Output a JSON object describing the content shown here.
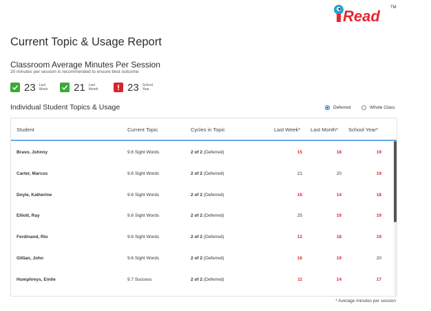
{
  "logo": {
    "text": "iRead",
    "tm": "TM"
  },
  "title": "Current Topic & Usage Report",
  "classroom": {
    "title": "Classroom Average Minutes Per Session",
    "subtitle": "20 minutes per session is recommended to ensure best outcome",
    "stats": [
      {
        "value": "23",
        "label1": "Last",
        "label2": "Week",
        "status": "green",
        "icon": "check-icon"
      },
      {
        "value": "21",
        "label1": "Last",
        "label2": "Month",
        "status": "green",
        "icon": "check-icon"
      },
      {
        "value": "23",
        "label1": "School",
        "label2": "Year",
        "status": "red",
        "icon": "exclamation-icon"
      }
    ]
  },
  "individual": {
    "title": "Individual Student Topics & Usage",
    "radio_deferred": "Deferred",
    "radio_whole_class": "Whole Class",
    "selected": "Deferred"
  },
  "table": {
    "headers": {
      "student": "Student",
      "topic": "Current Topic",
      "cycles": "Cycles in Topic",
      "last_week": "Last Week*",
      "last_month": "Last Month*",
      "school_year": "School Year*"
    },
    "rows": [
      {
        "student": "Bravo, Johnny",
        "topic": "9.6 Sight Words",
        "cycles_bold": "2 of 2",
        "cycles_note": "(Deferred)",
        "week": "15",
        "month": "18",
        "year": "19",
        "week_red": true,
        "month_red": true,
        "year_red": true
      },
      {
        "student": "Carter, Marcus",
        "topic": "9.6 Sight Words",
        "cycles_bold": "2 of 2",
        "cycles_note": "(Deferred)",
        "week": "21",
        "month": "20",
        "year": "19",
        "week_red": false,
        "month_red": false,
        "year_red": true
      },
      {
        "student": "Doyle, Katherine",
        "topic": "9.6 Sight Words",
        "cycles_bold": "2 of 2",
        "cycles_note": "(Deferred)",
        "week": "16",
        "month": "14",
        "year": "18",
        "week_red": true,
        "month_red": true,
        "year_red": true
      },
      {
        "student": "Elliott, Ray",
        "topic": "9.6 Sight Words",
        "cycles_bold": "2 of 2",
        "cycles_note": "(Deferred)",
        "week": "25",
        "month": "19",
        "year": "19",
        "week_red": false,
        "month_red": true,
        "year_red": true
      },
      {
        "student": "Ferdinand, Rio",
        "topic": "9.6 Sight Words",
        "cycles_bold": "2 of 2",
        "cycles_note": "(Deferred)",
        "week": "12",
        "month": "18",
        "year": "19",
        "week_red": true,
        "month_red": true,
        "year_red": true
      },
      {
        "student": "Gillian, John",
        "topic": "9.6 Sight Words",
        "cycles_bold": "2 of 2",
        "cycles_note": "(Deferred)",
        "week": "16",
        "month": "19",
        "year": "20",
        "week_red": true,
        "month_red": true,
        "year_red": false
      },
      {
        "student": "Humphreys, Emile",
        "topic": "9.7 Success",
        "cycles_bold": "2 of 2",
        "cycles_note": "(Deferred)",
        "week": "11",
        "month": "14",
        "year": "17",
        "week_red": true,
        "month_red": true,
        "year_red": true
      }
    ]
  },
  "footnote": "* Average minutes per session",
  "colors": {
    "accent": "#1a6fd6",
    "green": "#3aa935",
    "red": "#d9232e",
    "header_rule": "#6aa9e6"
  }
}
